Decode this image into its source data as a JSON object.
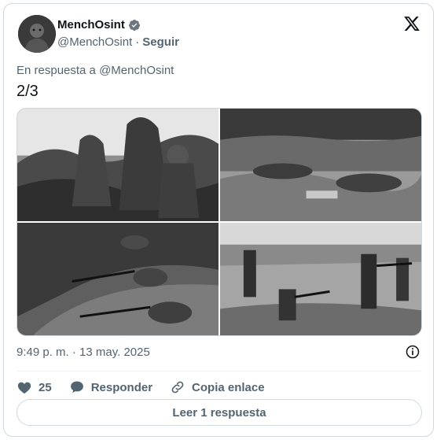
{
  "author": {
    "name": "MenchOsint",
    "handle": "@MenchOsint",
    "separator": "·",
    "follow_label": "Seguir",
    "verified_icon": "verified-badge-icon"
  },
  "brand_icon": "x-logo-icon",
  "reply_context": "En respuesta a @MenchOsint",
  "tweet_text": "2/3",
  "media": {
    "count": 4,
    "descriptions": []
  },
  "timestamp": "9:49 p. m. · 13 may. 2025",
  "actions": {
    "likes_count": "25",
    "reply_label": "Responder",
    "copy_label": "Copia enlace"
  },
  "read_replies_label": "Leer 1 respuesta",
  "colors": {
    "text": "#0f1419",
    "secondary": "#536471",
    "border": "#cfd9de"
  }
}
